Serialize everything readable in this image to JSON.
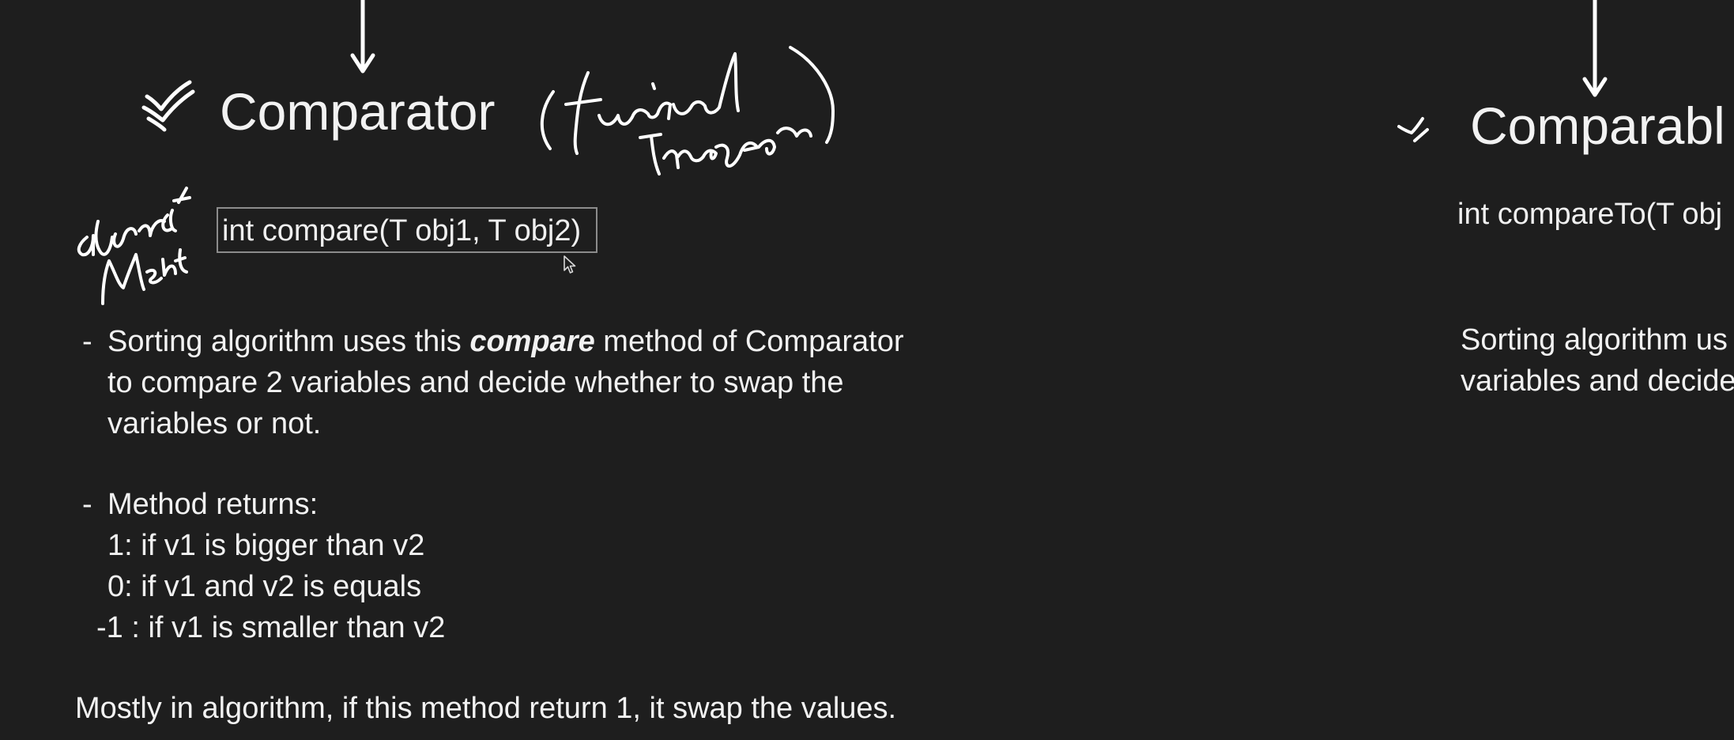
{
  "left_panel": {
    "heading": "Comparator",
    "handwritten_note": "(functional Interface)",
    "side_note": "abstract Method",
    "signature": "int compare(T obj1, T obj2)",
    "bullet1": {
      "before": "Sorting algorithm uses this ",
      "keyword": "compare",
      "after": " method of Comparator",
      "line2": "to compare 2 variables and decide whether to swap the",
      "line3": "variables or not."
    },
    "bullet2": {
      "title": "Method returns:",
      "items": [
        "1: if v1 is bigger than v2",
        "0: if v1 and v2 is equals",
        "-1 : if v1 is smaller than v2"
      ]
    },
    "footer": "Mostly in algorithm, if this method return 1, it swap the values."
  },
  "right_panel": {
    "heading": "Comparabl",
    "signature": "int compareTo(T obj",
    "text_line1": "Sorting algorithm us",
    "text_line2": "variables and decide"
  },
  "bullet_marker": "-"
}
